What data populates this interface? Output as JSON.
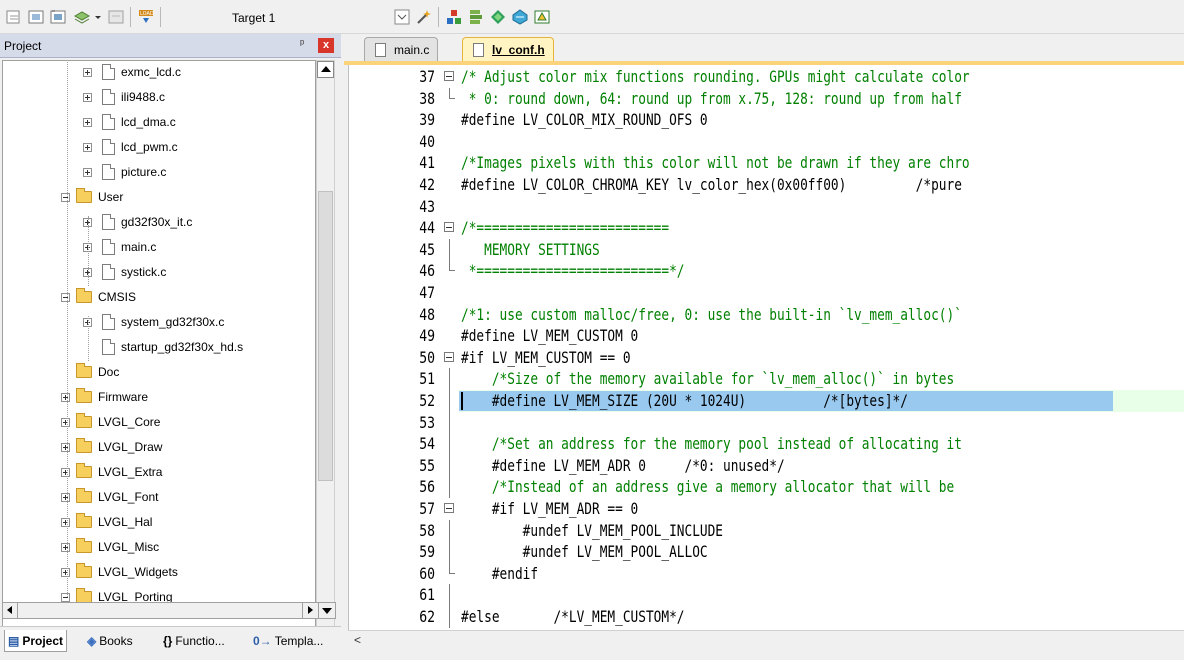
{
  "toolbar": {
    "target_label": "Target 1",
    "buttons": [
      "translate-icon",
      "build-icon",
      "rebuild-icon",
      "batch-build-icon",
      "stop-build-icon",
      "download-icon"
    ],
    "right_buttons": [
      "options-icon",
      "manage-components-icon",
      "pack-installer-icon",
      "select-packs-icon",
      "event-recorder-icon"
    ]
  },
  "project_panel": {
    "title": "Project",
    "pin_icon": "pin-icon",
    "close_label": "x",
    "tree": [
      {
        "type": "file",
        "label": "exmc_lcd.c"
      },
      {
        "type": "file",
        "label": "ili9488.c"
      },
      {
        "type": "file",
        "label": "lcd_dma.c"
      },
      {
        "type": "file",
        "label": "lcd_pwm.c"
      },
      {
        "type": "file",
        "label": "picture.c"
      },
      {
        "type": "folder",
        "label": "User"
      },
      {
        "type": "file",
        "label": "gd32f30x_it.c"
      },
      {
        "type": "file",
        "label": "main.c"
      },
      {
        "type": "file",
        "label": "systick.c"
      },
      {
        "type": "folder",
        "label": "CMSIS"
      },
      {
        "type": "file",
        "label": "system_gd32f30x.c"
      },
      {
        "type": "file",
        "label": "startup_gd32f30x_hd.s"
      },
      {
        "type": "folder",
        "label": "Doc"
      },
      {
        "type": "folder",
        "label": "Firmware"
      },
      {
        "type": "folder",
        "label": "LVGL_Core"
      },
      {
        "type": "folder",
        "label": "LVGL_Draw"
      },
      {
        "type": "folder",
        "label": "LVGL_Extra"
      },
      {
        "type": "folder",
        "label": "LVGL_Font"
      },
      {
        "type": "folder",
        "label": "LVGL_Hal"
      },
      {
        "type": "folder",
        "label": "LVGL_Misc"
      },
      {
        "type": "folder",
        "label": "LVGL_Widgets"
      },
      {
        "type": "folder",
        "label": "LVGL_Porting"
      }
    ],
    "bottom_tabs": [
      {
        "icon": "▤",
        "label": "Project"
      },
      {
        "icon": "◈",
        "label": "Books"
      },
      {
        "icon": "{}",
        "label": "Functio..."
      },
      {
        "icon": "0→",
        "label": "Templa..."
      }
    ]
  },
  "editor": {
    "tabs": [
      {
        "label": "main.c",
        "active": false
      },
      {
        "label": "lv_conf.h",
        "active": true
      }
    ],
    "lines": [
      {
        "n": "37",
        "text": "/* Adjust color mix functions rounding. GPUs might calculate color"
      },
      {
        "n": "38",
        "text": " * 0: round down, 64: round up from x.75, 128: round up from half"
      },
      {
        "n": "39",
        "text": "#define LV_COLOR_MIX_ROUND_OFS 0"
      },
      {
        "n": "40",
        "text": ""
      },
      {
        "n": "41",
        "text": "/*Images pixels with this color will not be drawn if they are chro"
      },
      {
        "n": "42",
        "text": "#define LV_COLOR_CHROMA_KEY lv_color_hex(0x00ff00)         /*pure"
      },
      {
        "n": "43",
        "text": ""
      },
      {
        "n": "44",
        "text": "/*========================="
      },
      {
        "n": "45",
        "text": "   MEMORY SETTINGS"
      },
      {
        "n": "46",
        "text": " *=========================*/"
      },
      {
        "n": "47",
        "text": ""
      },
      {
        "n": "48",
        "text": "/*1: use custom malloc/free, 0: use the built-in `lv_mem_alloc()`"
      },
      {
        "n": "49",
        "text": "#define LV_MEM_CUSTOM 0"
      },
      {
        "n": "50",
        "text": "#if LV_MEM_CUSTOM == 0"
      },
      {
        "n": "51",
        "text": "    /*Size of the memory available for `lv_mem_alloc()` in bytes"
      },
      {
        "n": "52",
        "text": "    #define LV_MEM_SIZE (20U * 1024U)          /*[bytes]*/"
      },
      {
        "n": "53",
        "text": ""
      },
      {
        "n": "54",
        "text": "    /*Set an address for the memory pool instead of allocating it"
      },
      {
        "n": "55",
        "text": "    #define LV_MEM_ADR 0     /*0: unused*/"
      },
      {
        "n": "56",
        "text": "    /*Instead of an address give a memory allocator that will be"
      },
      {
        "n": "57",
        "text": "    #if LV_MEM_ADR == 0"
      },
      {
        "n": "58",
        "text": "        #undef LV_MEM_POOL_INCLUDE"
      },
      {
        "n": "59",
        "text": "        #undef LV_MEM_POOL_ALLOC"
      },
      {
        "n": "60",
        "text": "    #endif"
      },
      {
        "n": "61",
        "text": ""
      },
      {
        "n": "62",
        "text": "#else       /*LV_MEM_CUSTOM*/"
      }
    ],
    "hscroll_arrow": "<"
  }
}
